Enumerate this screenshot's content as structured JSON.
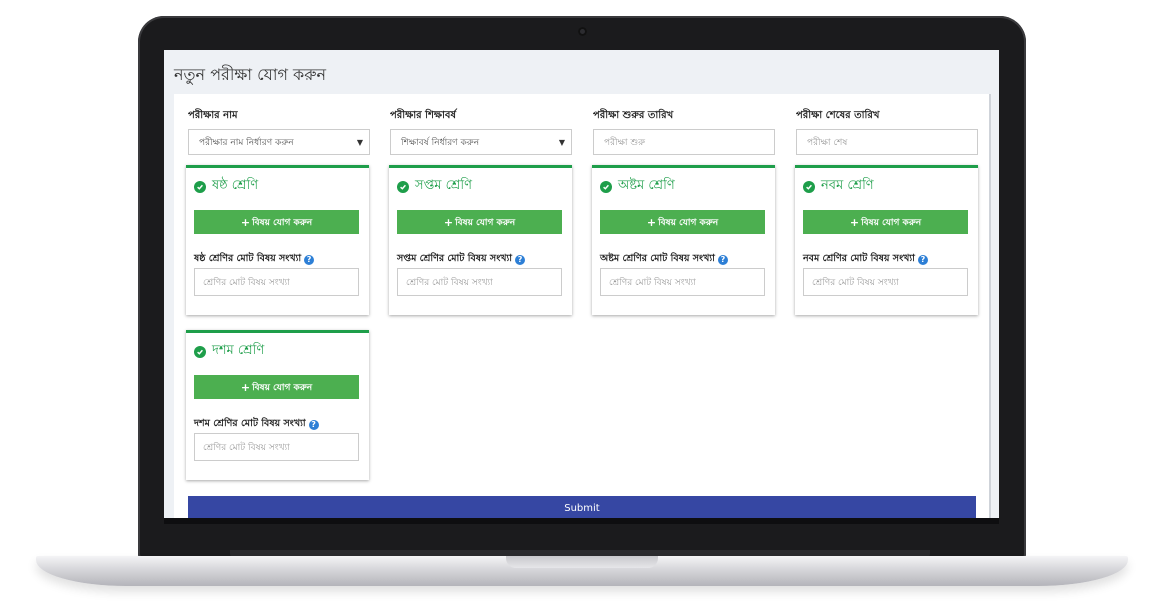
{
  "page": {
    "title": "নতুন পরীক্ষা যোগ করুন"
  },
  "form": {
    "exam_name": {
      "label": "পরীক্ষার নাম",
      "value": "পরীক্ষার নাম নির্ধারণ করুন"
    },
    "exam_year": {
      "label": "পরীক্ষার শিক্ষাবর্ষ",
      "value": "শিক্ষাবর্ষ নির্ধারণ করুন"
    },
    "start_date": {
      "label": "পরীক্ষা শুরুর তারিখ",
      "placeholder": "পরীক্ষা শুরু"
    },
    "end_date": {
      "label": "পরীক্ষা শেষের তারিখ",
      "placeholder": "পরীক্ষা শেষ"
    }
  },
  "panels": [
    {
      "title": "ষষ্ঠ শ্রেণি",
      "add_label": "বিষয় যোগ করুন",
      "count_label": "ষষ্ঠ শ্রেণির মোট বিষয় সংখ্যা",
      "count_placeholder": "শ্রেণির মোট বিষয় সংখ্যা"
    },
    {
      "title": "সপ্তম শ্রেণি",
      "add_label": "বিষয় যোগ করুন",
      "count_label": "সপ্তম শ্রেণির মোট বিষয় সংখ্যা",
      "count_placeholder": "শ্রেণির মোট বিষয় সংখ্যা"
    },
    {
      "title": "অষ্টম শ্রেণি",
      "add_label": "বিষয় যোগ করুন",
      "count_label": "অষ্টম শ্রেণির মোট বিষয় সংখ্যা",
      "count_placeholder": "শ্রেণির মোট বিষয় সংখ্যা"
    },
    {
      "title": "নবম শ্রেণি",
      "add_label": "বিষয় যোগ করুন",
      "count_label": "নবম শ্রেণির মোট বিষয় সংখ্যা",
      "count_placeholder": "শ্রেণির মোট বিষয় সংখ্যা"
    },
    {
      "title": "দশম শ্রেণি",
      "add_label": "বিষয় যোগ করুন",
      "count_label": "দশম শ্রেণির মোট বিষয় সংখ্যা",
      "count_placeholder": "শ্রেণির মোট বিষয় সংখ্যা"
    }
  ],
  "submit_label": "Submit",
  "icons": {
    "check": "check-circle-icon",
    "help": "question-circle-icon",
    "caret": "chevron-down-icon",
    "plus": "plus-icon"
  },
  "colors": {
    "accent_green": "#1e9e4a",
    "button_green": "#4caf50",
    "submit_blue": "#3647a3",
    "help_blue": "#2d7fd6"
  }
}
